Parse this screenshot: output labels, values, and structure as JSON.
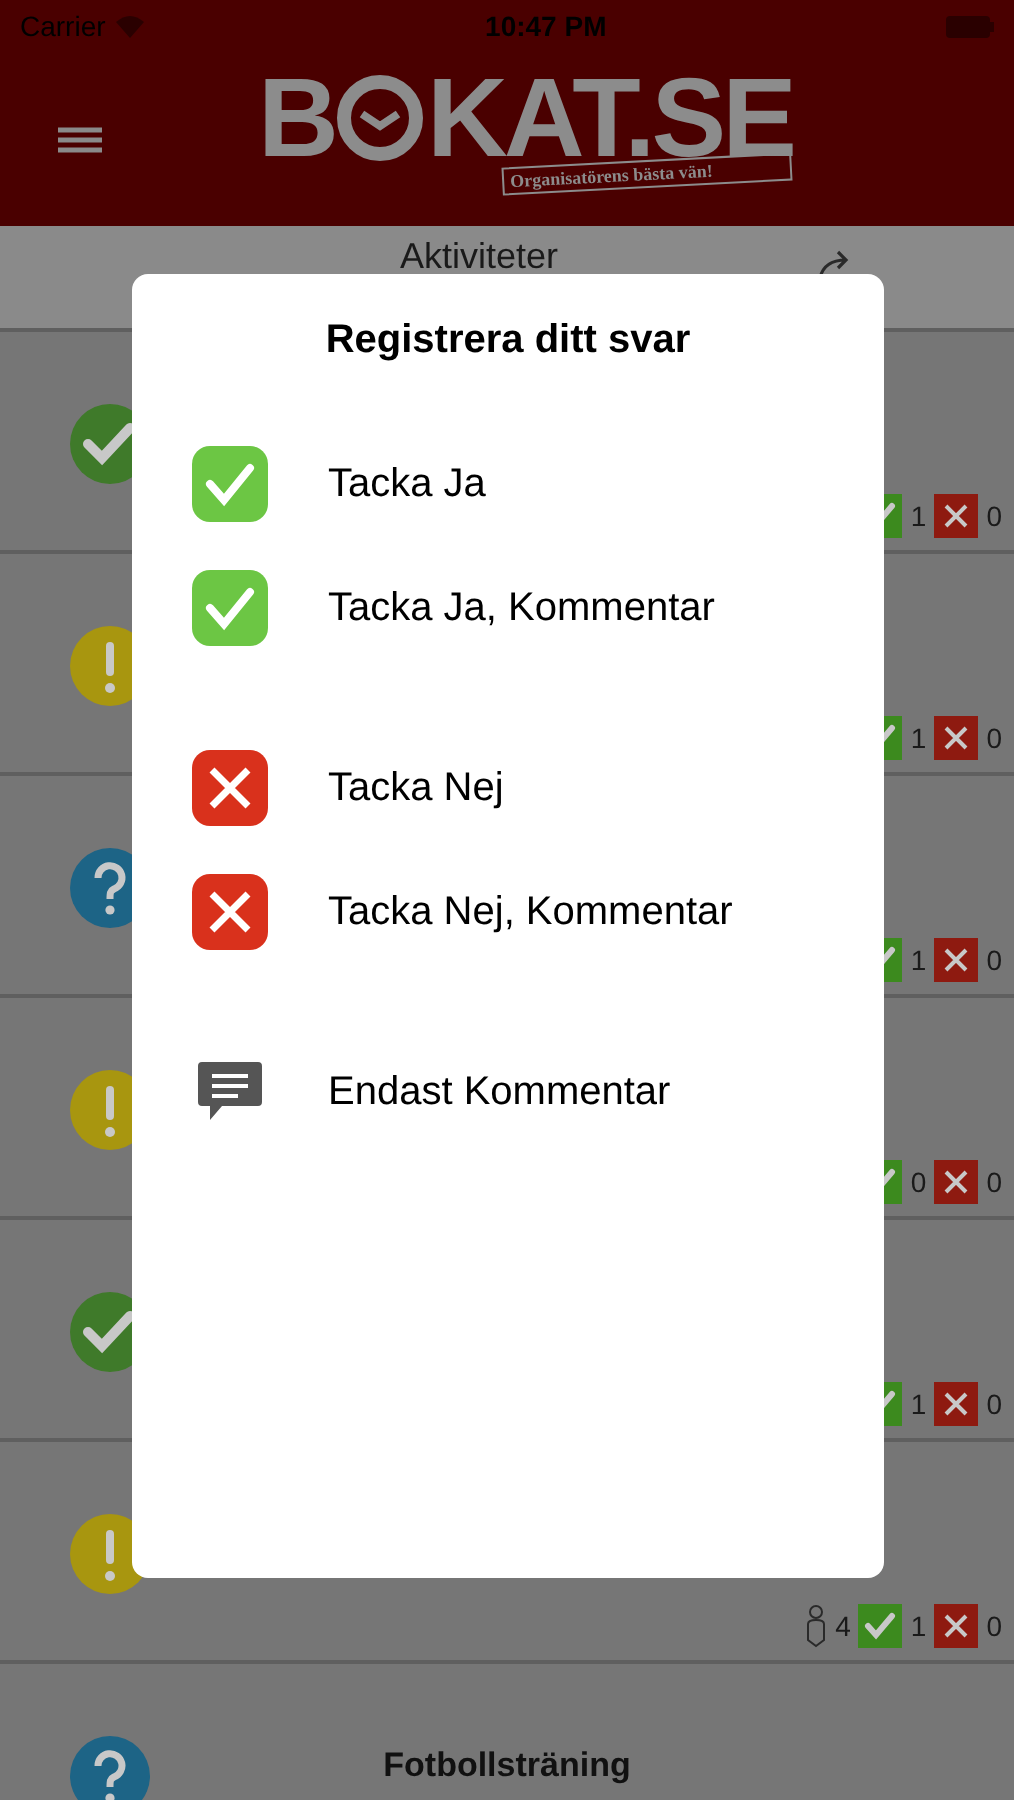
{
  "status_bar": {
    "carrier": "Carrier",
    "time": "10:47 PM"
  },
  "logo": {
    "left": "B",
    "right": "KAT.SE",
    "tagline": "Organisatörens bästa vän!"
  },
  "subheader": {
    "title": "Aktiviteter"
  },
  "rows": [
    {
      "kind": "yes",
      "yes": "1",
      "no": "0"
    },
    {
      "kind": "maybe",
      "yes": "1",
      "no": "0"
    },
    {
      "kind": "unknown",
      "yes": "1",
      "no": "0"
    },
    {
      "kind": "maybe",
      "yes": "0",
      "no": "0"
    },
    {
      "kind": "yes",
      "yes": "1",
      "no": "0"
    },
    {
      "kind": "maybe",
      "attendees": "4",
      "yes": "1",
      "no": "0"
    },
    {
      "kind": "unknown",
      "title": "Fotbollsträning"
    }
  ],
  "dialog": {
    "title": "Registrera ditt svar",
    "options": [
      {
        "kind": "yes",
        "label": "Tacka Ja"
      },
      {
        "kind": "yes",
        "label": "Tacka Ja, Kommentar"
      },
      {
        "kind": "no",
        "label": "Tacka Nej"
      },
      {
        "kind": "no",
        "label": "Tacka Nej, Kommentar"
      },
      {
        "kind": "comment",
        "label": "Endast Kommentar"
      }
    ]
  }
}
